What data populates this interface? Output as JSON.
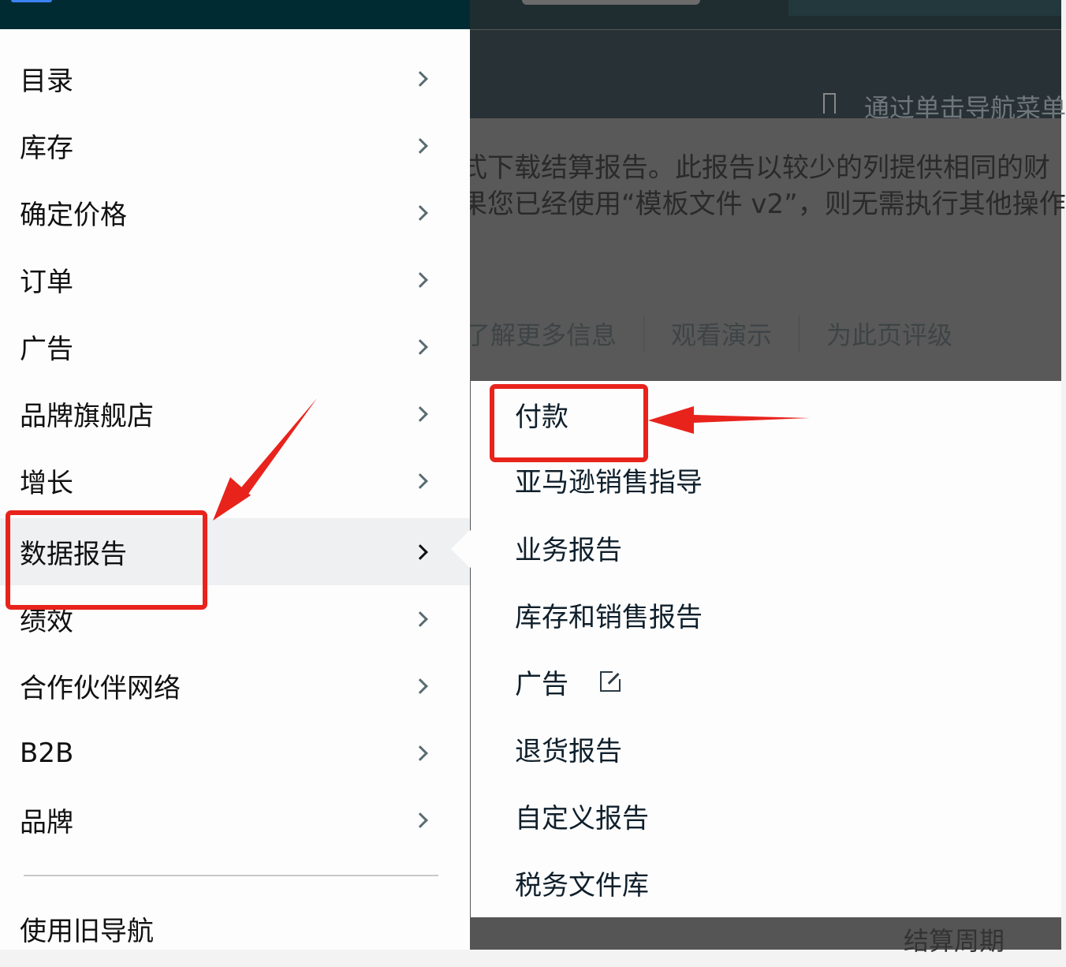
{
  "background": {
    "header_hint": "通过单击导航菜单",
    "description_lines": [
      "式下载结算报告。此报告以较少的列提供相同的财",
      "果您已经使用“模板文件 v2”，则无需执行其他操作"
    ],
    "links": [
      "了解更多信息",
      "观看演示",
      "为此页评级"
    ],
    "footer_label": "结算周期"
  },
  "menu": {
    "items": [
      {
        "label": "目录"
      },
      {
        "label": "库存"
      },
      {
        "label": "确定价格"
      },
      {
        "label": "订单"
      },
      {
        "label": "广告"
      },
      {
        "label": "品牌旗舰店"
      },
      {
        "label": "增长"
      },
      {
        "label": "数据报告",
        "active": true
      },
      {
        "label": "绩效"
      },
      {
        "label": "合作伙伴网络"
      },
      {
        "label": "B2B"
      },
      {
        "label": "品牌"
      }
    ],
    "legacy_nav": "使用旧导航"
  },
  "submenu": {
    "items": [
      {
        "label": "付款"
      },
      {
        "label": "亚马逊销售指导"
      },
      {
        "label": "业务报告"
      },
      {
        "label": "库存和销售报告"
      },
      {
        "label": "广告",
        "icon": "external-link-icon"
      },
      {
        "label": "退货报告"
      },
      {
        "label": "自定义报告"
      },
      {
        "label": "税务文件库"
      }
    ]
  },
  "colors": {
    "annotation": "#e8231c",
    "topbar": "#012b32",
    "active_row": "#eef0f2"
  }
}
